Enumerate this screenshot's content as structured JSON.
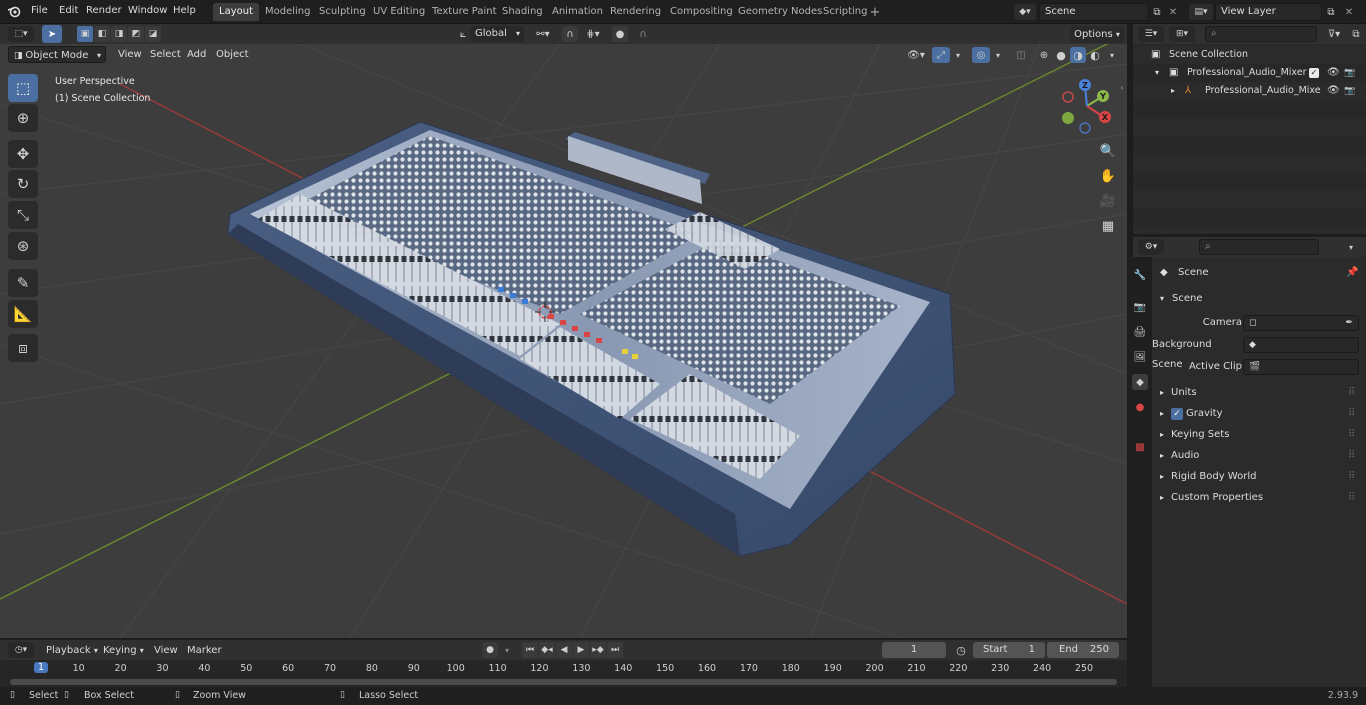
{
  "menu": {
    "items": [
      "File",
      "Edit",
      "Render",
      "Window",
      "Help"
    ]
  },
  "workspaces": [
    "Layout",
    "Modeling",
    "Sculpting",
    "UV Editing",
    "Texture Paint",
    "Shading",
    "Animation",
    "Rendering",
    "Compositing",
    "Geometry Nodes",
    "Scripting"
  ],
  "scene_field": "Scene",
  "view_layer_field": "View Layer",
  "viewport_header": {
    "mode": "Object Mode",
    "menus": [
      "View",
      "Select",
      "Add",
      "Object"
    ],
    "transform_orientation": "Global",
    "options_label": "Options"
  },
  "viewport": {
    "perspective": "User Perspective",
    "collection": "(1) Scene Collection",
    "gizmo_axes": {
      "x": "X",
      "y": "Y",
      "z": "Z"
    }
  },
  "outliner": {
    "rows": [
      {
        "label": "Scene Collection"
      },
      {
        "label": "Professional_Audio_Mixer"
      },
      {
        "label": "Professional_Audio_Mixe"
      }
    ]
  },
  "properties": {
    "header_label": "Scene",
    "section_label": "Scene",
    "fields": [
      {
        "label": "Camera"
      },
      {
        "label": "Background Scene"
      },
      {
        "label": "Active Clip"
      }
    ],
    "panels": [
      "Units",
      "Gravity",
      "Keying Sets",
      "Audio",
      "Rigid Body World",
      "Custom Properties"
    ]
  },
  "timeline": {
    "menus": [
      "Playback",
      "Keying",
      "View",
      "Marker"
    ],
    "current_frame": "1",
    "start_label": "Start",
    "start_value": "1",
    "end_label": "End",
    "end_value": "250",
    "ruler": [
      "1",
      "10",
      "20",
      "30",
      "40",
      "50",
      "60",
      "70",
      "80",
      "90",
      "100",
      "110",
      "120",
      "130",
      "140",
      "150",
      "160",
      "170",
      "180",
      "190",
      "200",
      "210",
      "220",
      "230",
      "240",
      "250"
    ]
  },
  "statusbar": {
    "items": [
      "Select",
      "Box Select",
      "Zoom View",
      "Lasso Select"
    ],
    "version": "2.93.9"
  }
}
